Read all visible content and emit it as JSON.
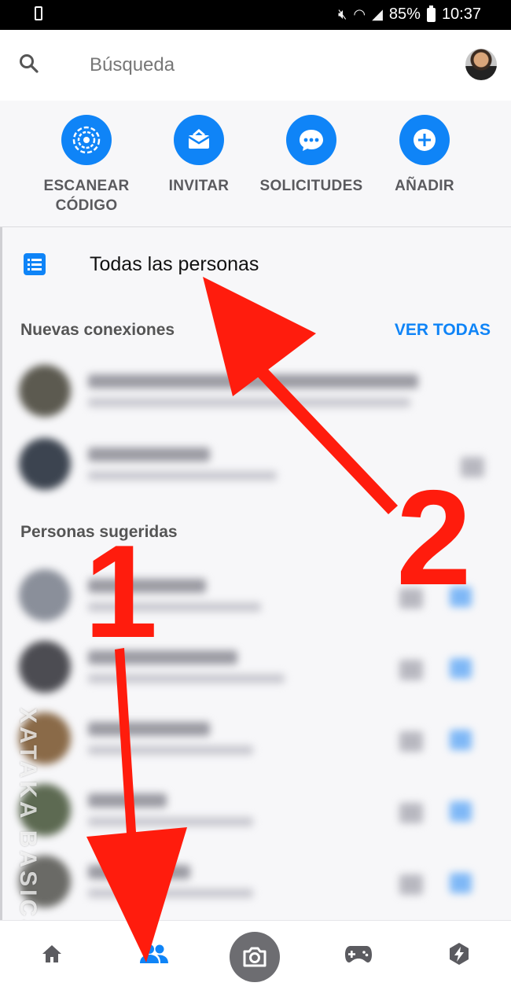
{
  "status_bar": {
    "battery": "85%",
    "time": "10:37"
  },
  "search": {
    "placeholder": "Búsqueda",
    "icon": "search-icon"
  },
  "actions": [
    {
      "label": "ESCANEAR\nCÓDIGO",
      "icon": "scan-code-icon"
    },
    {
      "label": "INVITAR",
      "icon": "invite-icon"
    },
    {
      "label": "SOLICITUDES",
      "icon": "requests-icon"
    },
    {
      "label": "AÑADIR",
      "icon": "add-icon"
    }
  ],
  "all_people": {
    "label": "Todas las personas",
    "icon": "list-icon"
  },
  "new_connections": {
    "title": "Nuevas conexiones",
    "see_all": "VER TODAS"
  },
  "suggested": {
    "title": "Personas sugeridas"
  },
  "annotations": {
    "step1": "1",
    "step2": "2"
  },
  "watermark": "XATAKA BASICS",
  "bottom_nav": [
    "home-icon",
    "people-icon",
    "camera-icon",
    "games-icon",
    "discover-icon"
  ],
  "colors": {
    "accent": "#0f84f7",
    "annotation": "#ff1c0d"
  }
}
